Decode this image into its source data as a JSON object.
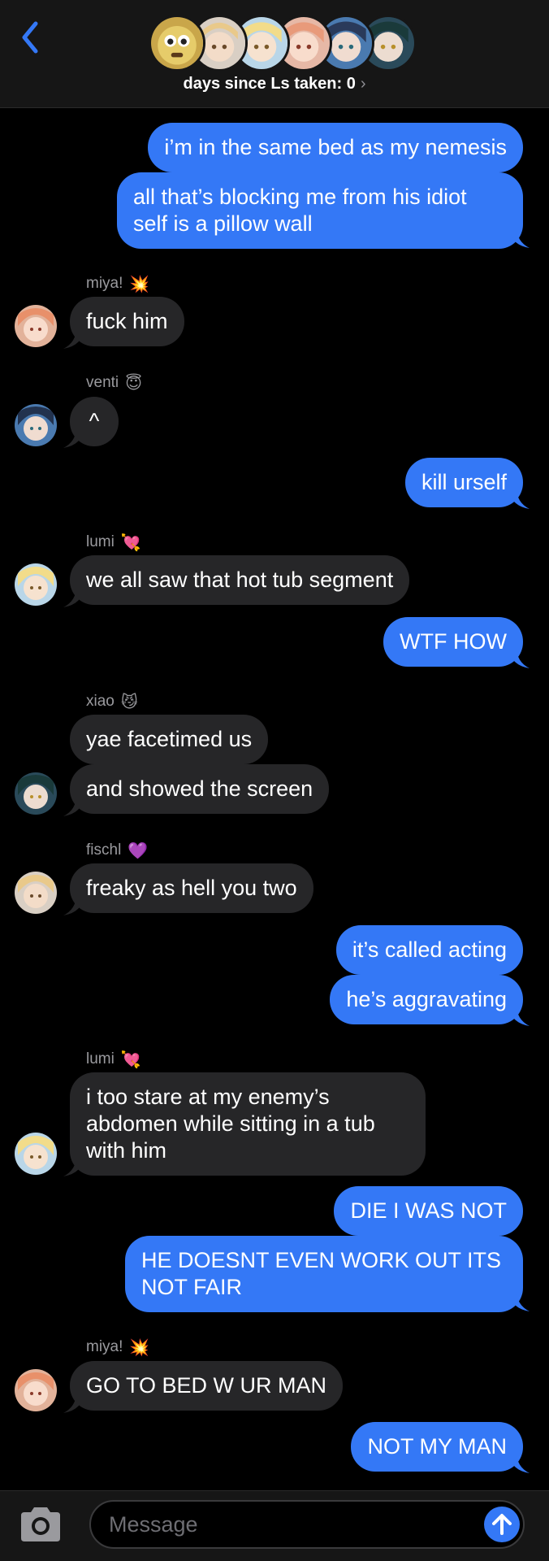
{
  "header": {
    "subtitle": "days since Ls taken: 0",
    "chevron": "›",
    "back_icon": "chevron-left-icon"
  },
  "colors": {
    "outgoing": "#3478f6",
    "incoming": "#262628",
    "background": "#000000",
    "name_label": "#9a9a9e"
  },
  "messages": [
    {
      "from": "me",
      "text": "i’m in the same bed as my nemesis"
    },
    {
      "from": "me",
      "text": "all that’s blocking me from his idiot",
      "text2": "self is a pillow wall"
    },
    {
      "from": "miya!",
      "emoji": "💥",
      "text": "fuck him"
    },
    {
      "from": "venti",
      "emoji": "😇",
      "text": "^"
    },
    {
      "from": "me",
      "text": "kill urself"
    },
    {
      "from": "lumi",
      "emoji": "💘",
      "text": "we all saw that hot tub segment"
    },
    {
      "from": "me",
      "text": "WTF HOW"
    },
    {
      "from": "xiao",
      "emoji": "😼",
      "text": "yae facetimed us"
    },
    {
      "from": "xiao",
      "text": "and showed the screen"
    },
    {
      "from": "fischl",
      "emoji": "💜",
      "text": "freaky as hell you two"
    },
    {
      "from": "me",
      "text": "it’s called acting"
    },
    {
      "from": "me",
      "text": "he’s aggravating"
    },
    {
      "from": "lumi",
      "emoji": "💘",
      "text": "i too stare at my enemy’s",
      "text2": "abdomen while sitting in a tub",
      "text3": "with him"
    },
    {
      "from": "me",
      "text": "DIE I WAS NOT"
    },
    {
      "from": "me",
      "text": "HE DOESNT EVEN WORK OUT ITS",
      "text2": "NOT FAIR"
    },
    {
      "from": "miya!",
      "emoji": "💥",
      "text": "GO TO BED W UR MAN"
    },
    {
      "from": "me",
      "text": "NOT MY MAN"
    }
  ],
  "input": {
    "placeholder": "Message",
    "camera_icon": "camera-icon",
    "send_icon": "arrow-up-icon"
  }
}
